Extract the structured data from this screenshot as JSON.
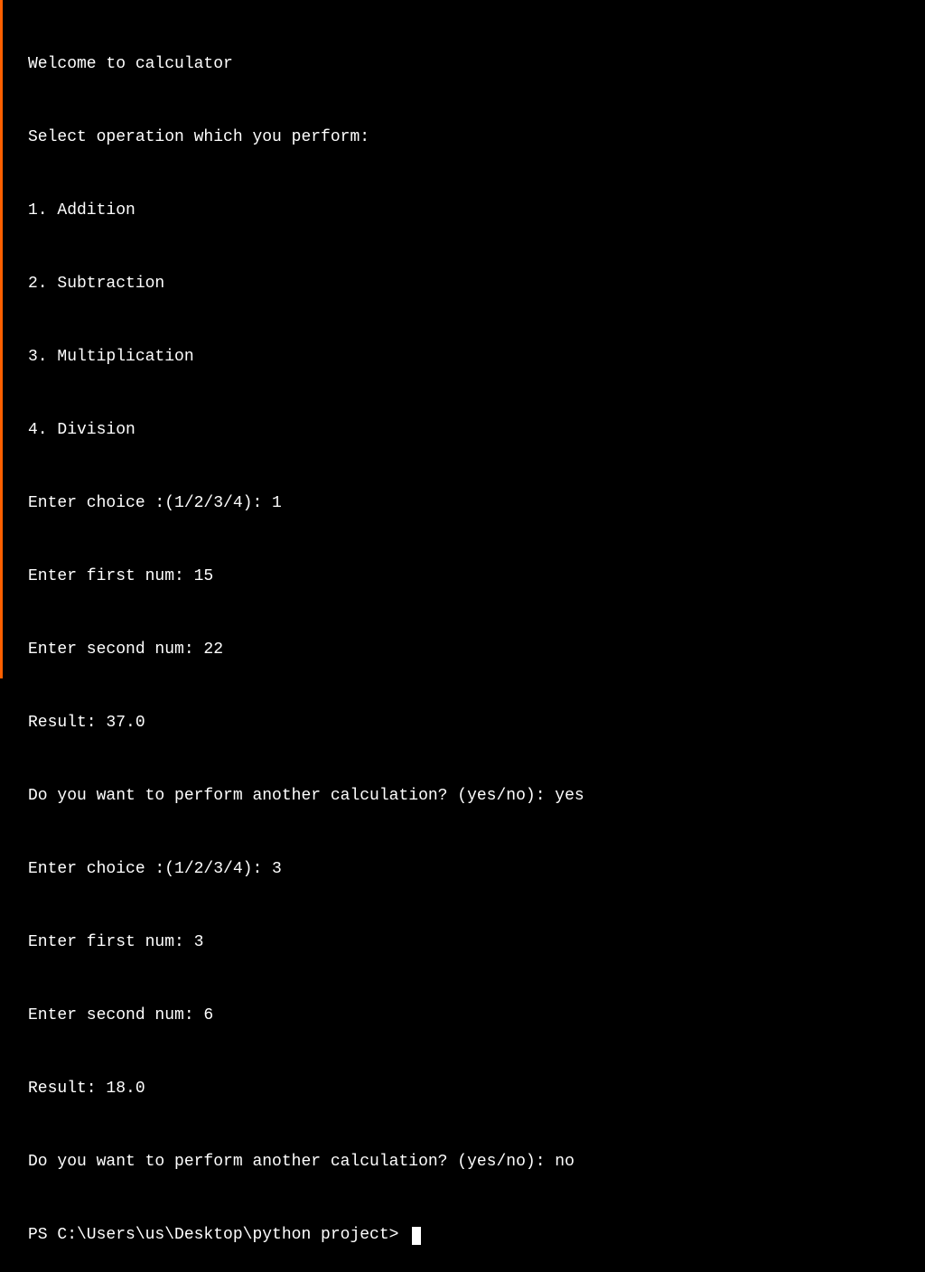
{
  "terminal": {
    "lines": [
      "Welcome to calculator",
      "Select operation which you perform:",
      "1. Addition",
      "2. Subtraction",
      "3. Multiplication",
      "4. Division",
      "Enter choice :(1/2/3/4): 1",
      "Enter first num: 15",
      "Enter second num: 22",
      "Result: 37.0",
      "Do you want to perform another calculation? (yes/no): yes",
      "Enter choice :(1/2/3/4): 3",
      "Enter first num: 3",
      "Enter second num: 6",
      "Result: 18.0",
      "Do you want to perform another calculation? (yes/no): no"
    ],
    "prompt": "PS C:\\Users\\us\\Desktop\\python project> "
  }
}
